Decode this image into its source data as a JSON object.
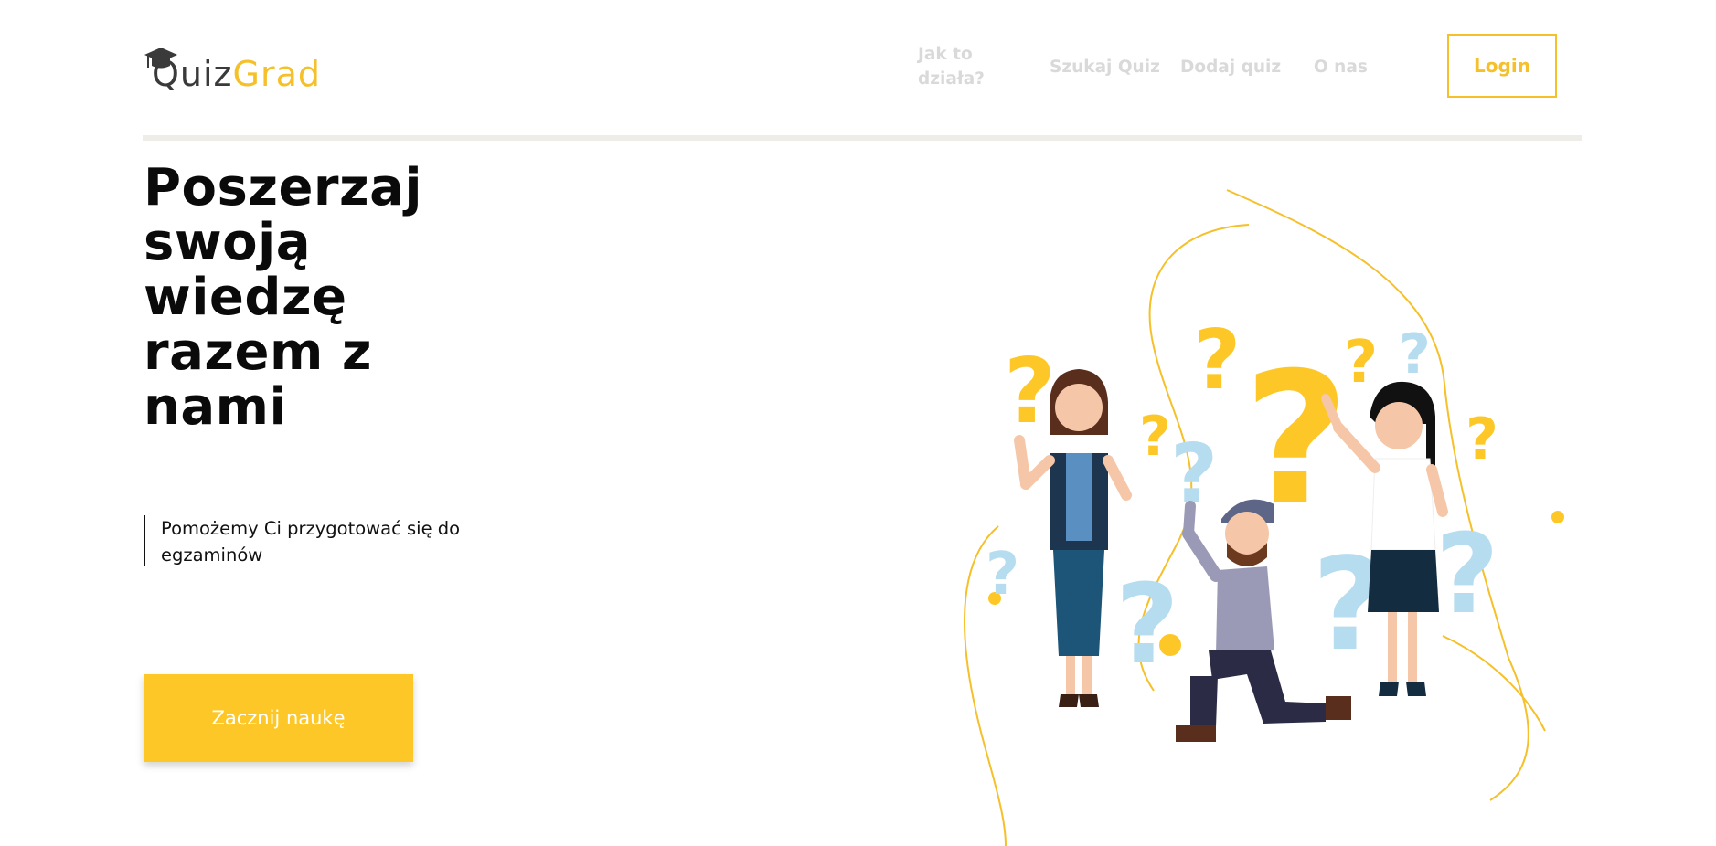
{
  "brand": {
    "part1": "Quiz",
    "part2": "Grad"
  },
  "nav": {
    "items": [
      {
        "label": "Jak to działa?"
      },
      {
        "label": "Szukaj Quiz"
      },
      {
        "label": "Dodaj quiz"
      },
      {
        "label": "O nas"
      }
    ],
    "login_label": "Login"
  },
  "hero": {
    "headline": "Poszerzaj swoją wiedzę razem z nami",
    "subtext": "Pomożemy Ci przygotować się do egzaminów",
    "cta_label": "Zacznij naukę"
  },
  "colors": {
    "accent": "#fdc827",
    "nav_text": "#d9d9d9",
    "divider": "#eeede7",
    "question_blue": "#b5dcef"
  },
  "icons": {
    "logo": "graduation-cap-icon",
    "illustration": "people-with-question-marks"
  }
}
